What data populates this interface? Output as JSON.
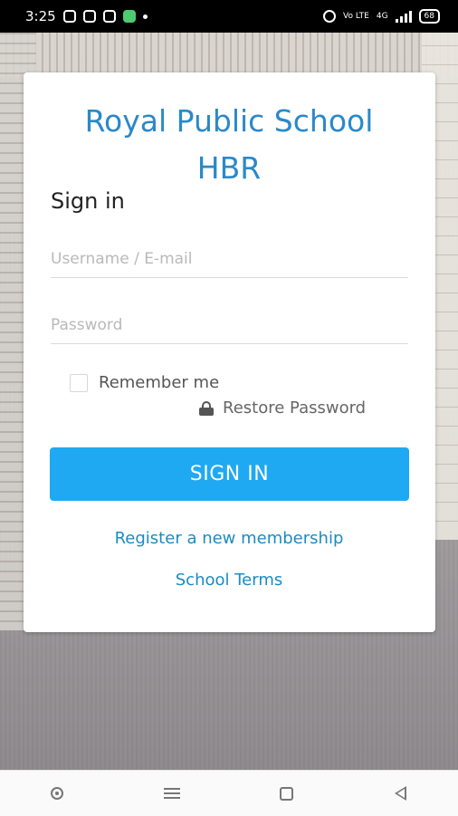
{
  "status_bar": {
    "time": "3:25",
    "network_label": "Vo LTE",
    "network_type": "4G",
    "battery": "68"
  },
  "school": {
    "name_line1": "Royal Public School",
    "name_line2": "HBR"
  },
  "form": {
    "heading": "Sign in",
    "username_placeholder": "Username / E-mail",
    "password_placeholder": "Password",
    "remember_label": "Remember me",
    "remember_checked": false,
    "restore_label": "Restore Password",
    "submit_label": "SIGN IN"
  },
  "links": {
    "register": "Register a new membership",
    "terms": "School Terms"
  },
  "colors": {
    "title": "#2a89c9",
    "button": "#1fa9f2",
    "link": "#1b8bc4"
  },
  "icons": {
    "restore": "lock-icon",
    "nav": [
      "circle-icon",
      "menu-icon",
      "square-icon",
      "back-icon"
    ]
  }
}
